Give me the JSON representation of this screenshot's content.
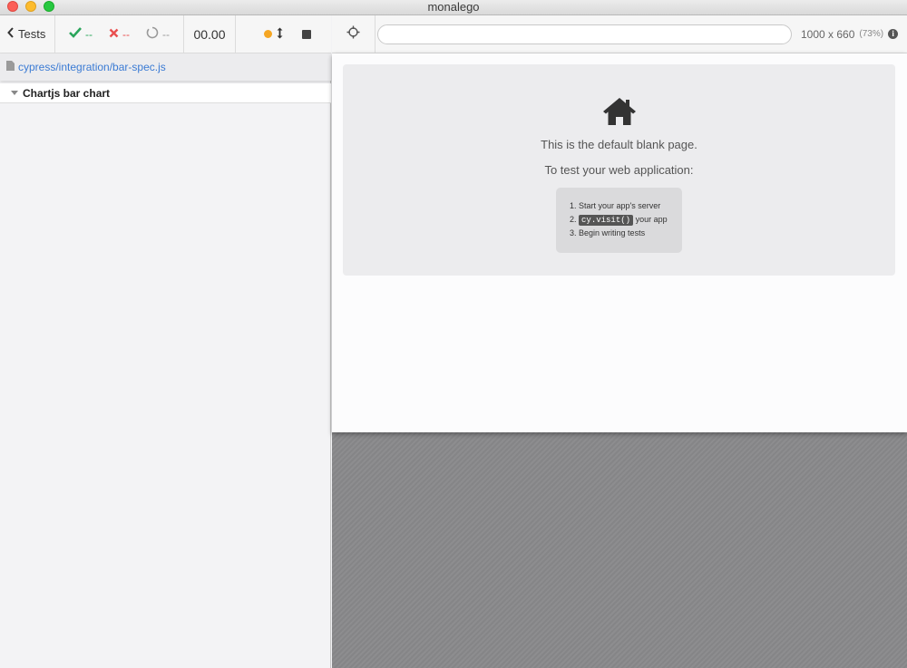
{
  "window": {
    "title": "monalego"
  },
  "reporter": {
    "back_label": "Tests",
    "stats": {
      "passed": "--",
      "failed": "--",
      "pending": "--"
    },
    "duration": "00.00",
    "spec_path": "cypress/integration/bar-spec.js",
    "suite_title": "Chartjs bar chart"
  },
  "runner": {
    "url_value": "",
    "viewport_size": "1000 x 660",
    "zoom": "(73%)",
    "info_glyph": "i"
  },
  "blank_page": {
    "line1": "This is the default blank page.",
    "line2": "To test your web application:",
    "steps": [
      {
        "num": "1.",
        "text": "Start your app's server"
      },
      {
        "num": "2.",
        "code": "cy.visit()",
        "text": "your app"
      },
      {
        "num": "3.",
        "text": "Begin writing tests"
      }
    ]
  },
  "colors": {
    "pass": "#2aa55b",
    "fail": "#e94f4f",
    "running_dot": "#f5a623",
    "link": "#3b7bd4"
  },
  "icons": [
    "chevron-left-icon",
    "check-icon",
    "x-icon",
    "pending-circle-icon",
    "status-dot-icon",
    "resize-arrows-icon",
    "stop-icon",
    "file-icon",
    "caret-down-icon",
    "crosshair-icon",
    "info-icon",
    "home-icon"
  ]
}
